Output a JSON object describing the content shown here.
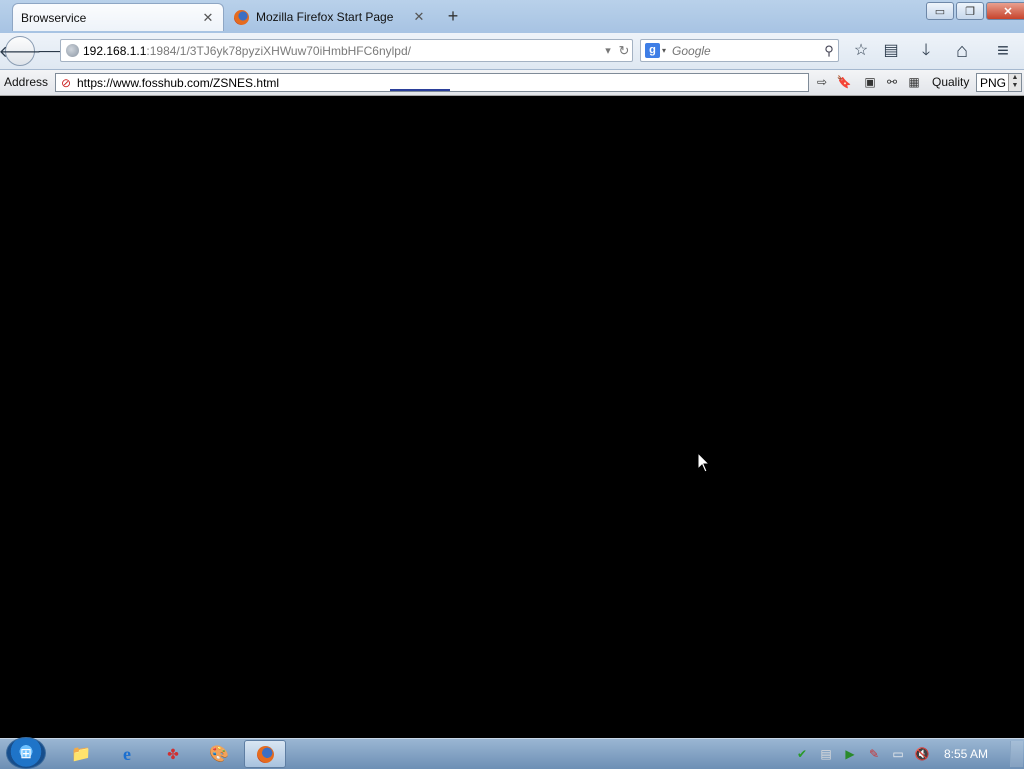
{
  "tabs": [
    {
      "label": "Browservice",
      "active": true
    },
    {
      "label": "Mozilla Firefox Start Page",
      "active": false
    }
  ],
  "urlbar": {
    "host": "192.168.1.1",
    "path": ":1984/1/3TJ6yk78pyziXHWuw70iHmbHFC6nylpd/"
  },
  "search": {
    "engine": "g",
    "placeholder": "Google"
  },
  "addressbar": {
    "label": "Address",
    "url": "https://www.fosshub.com/ZSNES.html",
    "quality_label": "Quality",
    "quality_value": "PNG"
  },
  "taskbar": {
    "clock": "8:55 AM"
  },
  "glyphs": {
    "close": "✕",
    "plus": "+",
    "back": "🡐",
    "forward": "🡒",
    "dropdown": "▾",
    "reload": "↻",
    "search": "⚲",
    "star": "☆",
    "bookmarks": "▤",
    "download": "🡓",
    "home": "⌂",
    "menu": "≡",
    "go": "⇨",
    "bookmark": "🔖",
    "minimize": "▭",
    "maximize": "❐",
    "windows": "⊞"
  },
  "colors": {
    "content_bg": "#000000",
    "taskbar": "#7f9fc2",
    "titlebar": "#b9d1ea"
  }
}
